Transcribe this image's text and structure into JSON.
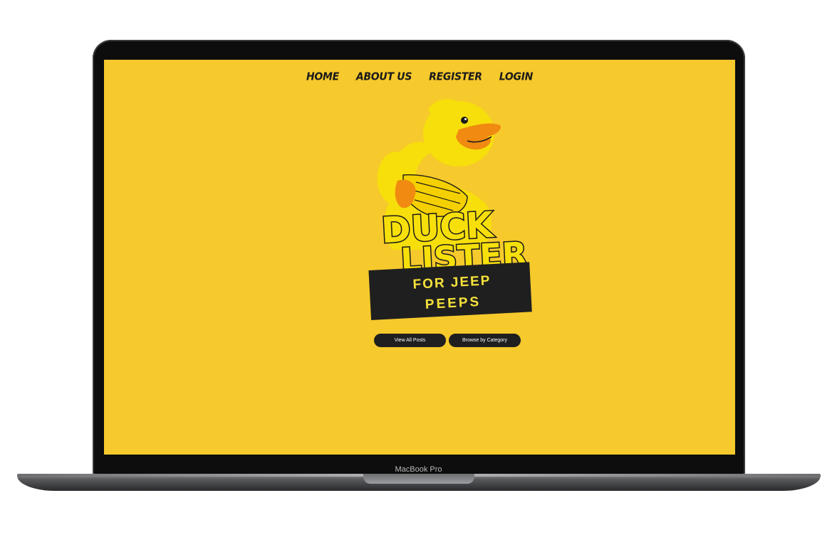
{
  "nav": {
    "items": [
      {
        "label": "HOME"
      },
      {
        "label": "ABOUT US"
      },
      {
        "label": "REGISTER"
      },
      {
        "label": "LOGIN"
      }
    ]
  },
  "logo": {
    "word1": "DUCK",
    "word2": "LISTER",
    "tagline_line1": "FOR JEEP",
    "tagline_line2": "PEEPS",
    "colors": {
      "duck": "#f7df0b",
      "beak": "#f08a10",
      "outline": "#1a1a1a",
      "banner": "#1f1f1f",
      "tagline": "#f6e23a"
    }
  },
  "buttons": {
    "view_all": "View All Posts",
    "browse_category": "Browse by Category"
  },
  "device": {
    "label": "MacBook Pro"
  },
  "colors": {
    "page_background": "#f6c92c",
    "button_background": "#1f1f1f"
  }
}
